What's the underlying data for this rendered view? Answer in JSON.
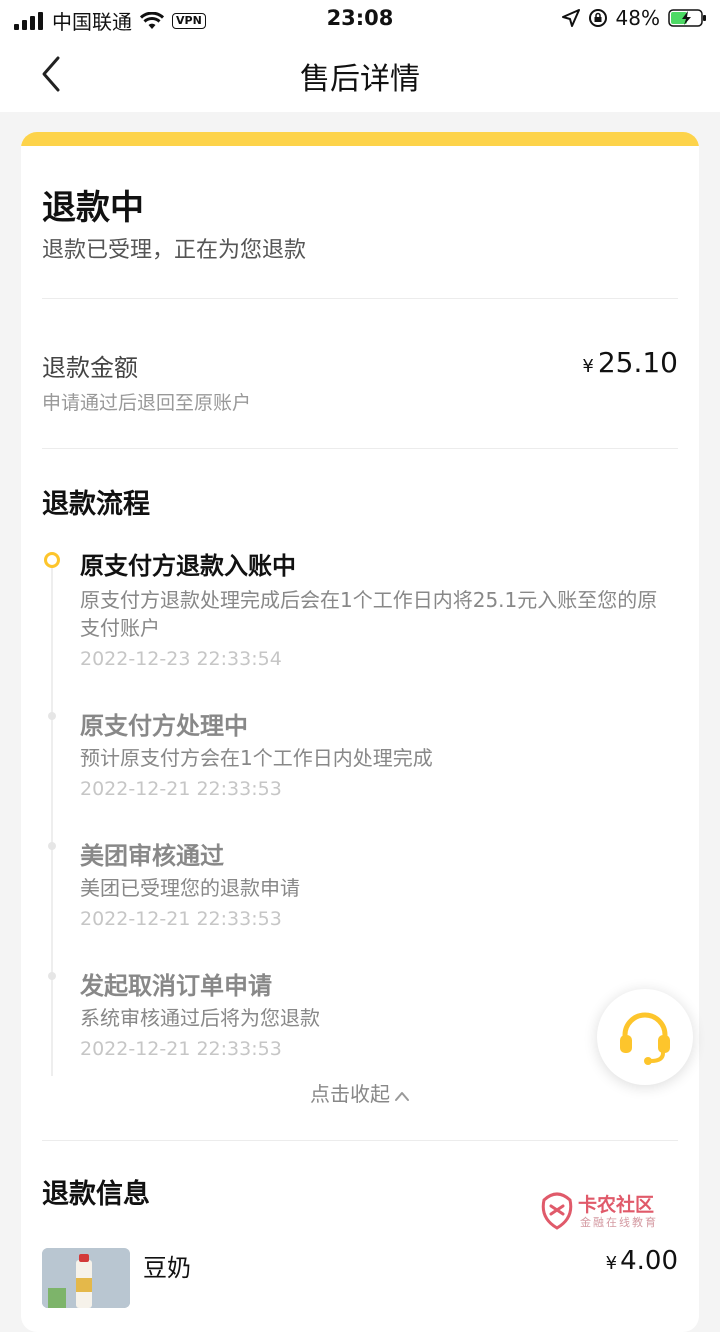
{
  "status_bar": {
    "carrier": "中国联通",
    "vpn": "VPN",
    "time": "23:08",
    "battery": "48%"
  },
  "nav": {
    "title": "售后详情",
    "back_icon": "chevron-left-icon"
  },
  "status": {
    "title": "退款中",
    "description": "退款已受理，正在为您退款"
  },
  "refund_amount": {
    "label": "退款金额",
    "currency": "¥",
    "value": "25.10",
    "note": "申请通过后退回至原账户"
  },
  "process": {
    "title": "退款流程",
    "steps": [
      {
        "title": "原支付方退款入账中",
        "description": "原支付方退款处理完成后会在1个工作日内将25.1元入账至您的原支付账户",
        "time": "2022-12-23 22:33:54"
      },
      {
        "title": "原支付方处理中",
        "description": "预计原支付方会在1个工作日内处理完成",
        "time": "2022-12-21 22:33:53"
      },
      {
        "title": "美团审核通过",
        "description": "美团已受理您的退款申请",
        "time": "2022-12-21 22:33:53"
      },
      {
        "title": "发起取消订单申请",
        "description": "系统审核通过后将为您退款",
        "time": "2022-12-21 22:33:53"
      }
    ],
    "collapse_label": "点击收起"
  },
  "refund_info": {
    "title": "退款信息",
    "items": [
      {
        "name": "豆奶",
        "currency": "¥",
        "price": "4.00"
      }
    ]
  },
  "watermark": {
    "line1": "卡农社区",
    "line2": "金融在线教育"
  },
  "colors": {
    "accent": "#fdd34a",
    "page_bg": "#f4f4f4"
  }
}
